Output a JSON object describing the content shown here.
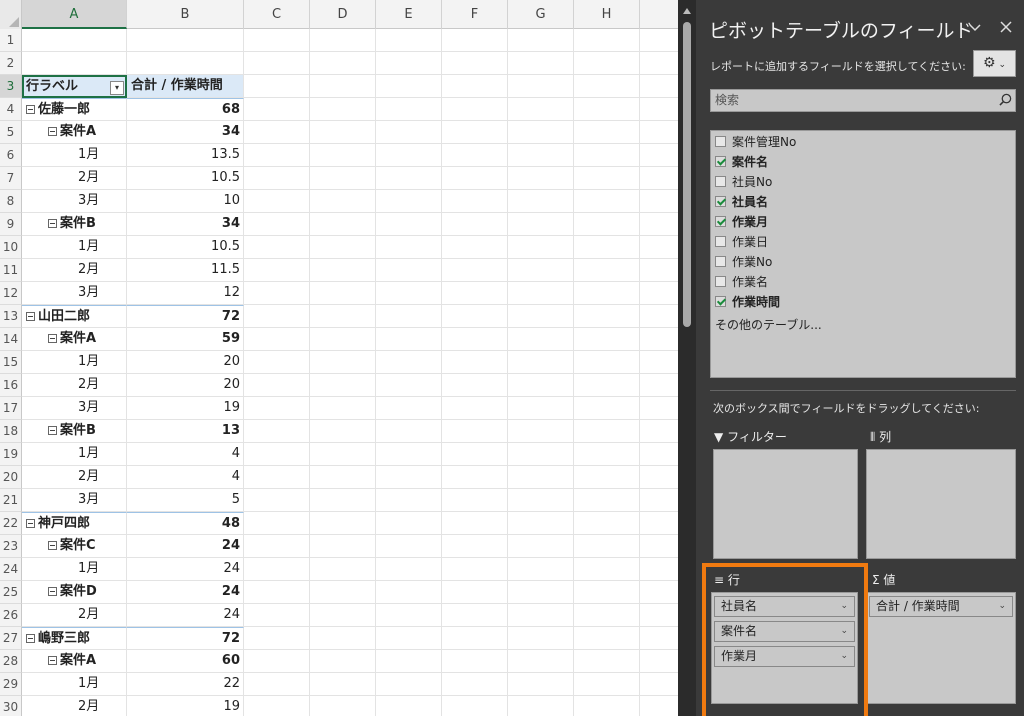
{
  "sheet": {
    "columns": [
      "A",
      "B",
      "C",
      "D",
      "E",
      "F",
      "G",
      "H"
    ],
    "selected_column": "A",
    "selected_row": "3",
    "header": {
      "row_label": "行ラベル",
      "value_label": "合計 / 作業時間"
    },
    "rows": [
      {
        "n": "1",
        "a": "",
        "b": "",
        "kind": "empty"
      },
      {
        "n": "2",
        "a": "",
        "b": "",
        "kind": "empty"
      },
      {
        "n": "3",
        "a": "行ラベル",
        "b": "合計 / 作業時間",
        "kind": "header"
      },
      {
        "n": "4",
        "a": "佐藤一郎",
        "b": "68",
        "kind": "l0"
      },
      {
        "n": "5",
        "a": "案件A",
        "b": "34",
        "kind": "l1"
      },
      {
        "n": "6",
        "a": "1月",
        "b": "13.5",
        "kind": "l2"
      },
      {
        "n": "7",
        "a": "2月",
        "b": "10.5",
        "kind": "l2"
      },
      {
        "n": "8",
        "a": "3月",
        "b": "10",
        "kind": "l2"
      },
      {
        "n": "9",
        "a": "案件B",
        "b": "34",
        "kind": "l1"
      },
      {
        "n": "10",
        "a": "1月",
        "b": "10.5",
        "kind": "l2"
      },
      {
        "n": "11",
        "a": "2月",
        "b": "11.5",
        "kind": "l2"
      },
      {
        "n": "12",
        "a": "3月",
        "b": "12",
        "kind": "l2"
      },
      {
        "n": "13",
        "a": "山田二郎",
        "b": "72",
        "kind": "l0"
      },
      {
        "n": "14",
        "a": "案件A",
        "b": "59",
        "kind": "l1"
      },
      {
        "n": "15",
        "a": "1月",
        "b": "20",
        "kind": "l2"
      },
      {
        "n": "16",
        "a": "2月",
        "b": "20",
        "kind": "l2"
      },
      {
        "n": "17",
        "a": "3月",
        "b": "19",
        "kind": "l2"
      },
      {
        "n": "18",
        "a": "案件B",
        "b": "13",
        "kind": "l1"
      },
      {
        "n": "19",
        "a": "1月",
        "b": "4",
        "kind": "l2"
      },
      {
        "n": "20",
        "a": "2月",
        "b": "4",
        "kind": "l2"
      },
      {
        "n": "21",
        "a": "3月",
        "b": "5",
        "kind": "l2"
      },
      {
        "n": "22",
        "a": "神戸四郎",
        "b": "48",
        "kind": "l0"
      },
      {
        "n": "23",
        "a": "案件C",
        "b": "24",
        "kind": "l1"
      },
      {
        "n": "24",
        "a": "1月",
        "b": "24",
        "kind": "l2"
      },
      {
        "n": "25",
        "a": "案件D",
        "b": "24",
        "kind": "l1"
      },
      {
        "n": "26",
        "a": "2月",
        "b": "24",
        "kind": "l2"
      },
      {
        "n": "27",
        "a": "嶋野三郎",
        "b": "72",
        "kind": "l0"
      },
      {
        "n": "28",
        "a": "案件A",
        "b": "60",
        "kind": "l1"
      },
      {
        "n": "29",
        "a": "1月",
        "b": "22",
        "kind": "l2"
      },
      {
        "n": "30",
        "a": "2月",
        "b": "19",
        "kind": "l2"
      }
    ]
  },
  "pane": {
    "title": "ピボットテーブルのフィールド",
    "subtitle": "レポートに追加するフィールドを選択してください:",
    "search_placeholder": "検索",
    "fields": [
      {
        "label": "案件管理No",
        "checked": false
      },
      {
        "label": "案件名",
        "checked": true
      },
      {
        "label": "社員No",
        "checked": false
      },
      {
        "label": "社員名",
        "checked": true
      },
      {
        "label": "作業月",
        "checked": true
      },
      {
        "label": "作業日",
        "checked": false
      },
      {
        "label": "作業No",
        "checked": false
      },
      {
        "label": "作業名",
        "checked": false
      },
      {
        "label": "作業時間",
        "checked": true
      }
    ],
    "more_tables": "その他のテーブル...",
    "drag_hint": "次のボックス間でフィールドをドラッグしてください:",
    "areas": {
      "filter_label": "フィルター",
      "columns_label": "列",
      "rows_label": "行",
      "values_label": "値",
      "rows_items": [
        "社員名",
        "案件名",
        "作業月"
      ],
      "values_items": [
        "合計 / 作業時間"
      ]
    },
    "highlight_color": "#f07a10",
    "checkmark_color": "#1a8c3c"
  }
}
